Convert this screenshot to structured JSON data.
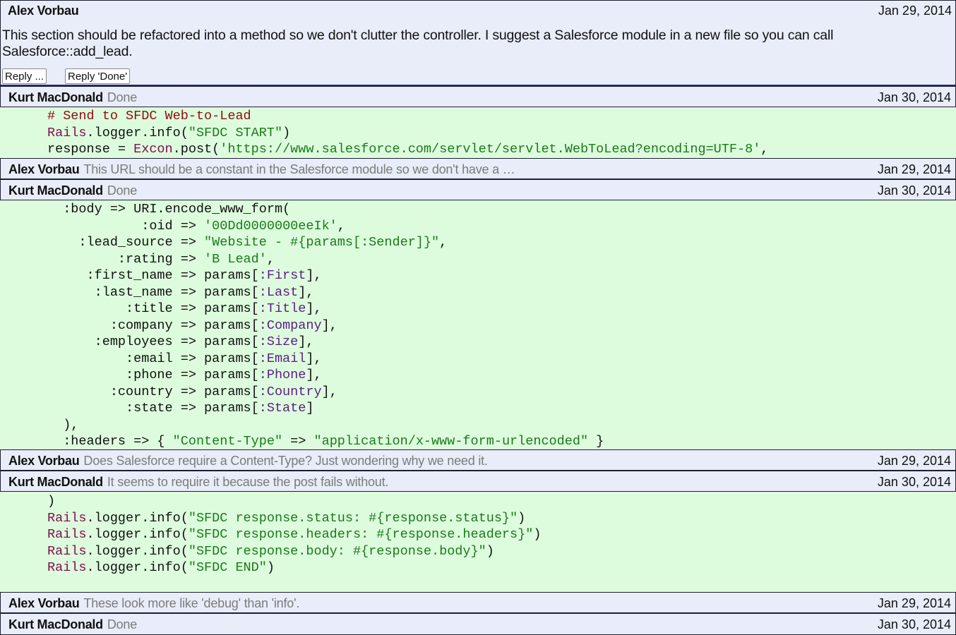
{
  "first_comment": {
    "author": "Alex Vorbau",
    "date": "Jan 29, 2014",
    "body_line1": "This section should be refactored into a method so we don't clutter the controller. I suggest a Salesforce module in a new file so you can call",
    "body_line2": "Salesforce::add_lead.",
    "reply_label": "Reply ...",
    "reply_done_label": "Reply 'Done'"
  },
  "threads": [
    {
      "author": "Kurt MacDonald",
      "message": "Done",
      "date": "Jan 30, 2014"
    },
    {
      "author": "Alex Vorbau",
      "message": "This URL should be a constant in the Salesforce module so we don't have a …",
      "date": "Jan 29, 2014"
    },
    {
      "author": "Kurt MacDonald",
      "message": "Done",
      "date": "Jan 30, 2014"
    },
    {
      "author": "Alex Vorbau",
      "message": "Does Salesforce require a Content-Type? Just wondering why we need it.",
      "date": "Jan 29, 2014"
    },
    {
      "author": "Kurt MacDonald",
      "message": "It seems to require it because the post fails without.",
      "date": "Jan 30, 2014"
    },
    {
      "author": "Alex Vorbau",
      "message": "These look more like 'debug' than 'info'.",
      "date": "Jan 29, 2014"
    },
    {
      "author": "Kurt MacDonald",
      "message": "Done",
      "date": "Jan 30, 2014"
    }
  ],
  "code_block_1": [
    [
      {
        "t": "# Send to SFDC Web-to-Lead",
        "c": "cmt"
      }
    ],
    [
      {
        "t": "Rails",
        "c": "kw-cls"
      },
      {
        "t": ".logger.info(",
        "c": ""
      },
      {
        "t": "\"SFDC START\"",
        "c": "str"
      },
      {
        "t": ")",
        "c": ""
      }
    ],
    [
      {
        "t": "response = ",
        "c": ""
      },
      {
        "t": "Excon",
        "c": "kw-cls"
      },
      {
        "t": ".post(",
        "c": ""
      },
      {
        "t": "'https://www.salesforce.com/servlet/servlet.WebToLead?encoding=UTF-8'",
        "c": "str"
      },
      {
        "t": ",",
        "c": ""
      }
    ]
  ],
  "code_block_2": [
    [
      {
        "t": "  :body => URI.encode_www_form(",
        "c": ""
      }
    ],
    [
      {
        "t": "            :oid => ",
        "c": ""
      },
      {
        "t": "'00Dd0000000eeIk'",
        "c": "str"
      },
      {
        "t": ",",
        "c": ""
      }
    ],
    [
      {
        "t": "    :lead_source => ",
        "c": ""
      },
      {
        "t": "\"Website - #{params[:Sender]}\"",
        "c": "str"
      },
      {
        "t": ",",
        "c": ""
      }
    ],
    [
      {
        "t": "         :rating => ",
        "c": ""
      },
      {
        "t": "'B Lead'",
        "c": "str"
      },
      {
        "t": ",",
        "c": ""
      }
    ],
    [
      {
        "t": "     :first_name => params[",
        "c": ""
      },
      {
        "t": ":First",
        "c": "sym"
      },
      {
        "t": "],",
        "c": ""
      }
    ],
    [
      {
        "t": "      :last_name => params[",
        "c": ""
      },
      {
        "t": ":Last",
        "c": "sym"
      },
      {
        "t": "],",
        "c": ""
      }
    ],
    [
      {
        "t": "          :title => params[",
        "c": ""
      },
      {
        "t": ":Title",
        "c": "sym"
      },
      {
        "t": "],",
        "c": ""
      }
    ],
    [
      {
        "t": "        :company => params[",
        "c": ""
      },
      {
        "t": ":Company",
        "c": "sym"
      },
      {
        "t": "],",
        "c": ""
      }
    ],
    [
      {
        "t": "      :employees => params[",
        "c": ""
      },
      {
        "t": ":Size",
        "c": "sym"
      },
      {
        "t": "],",
        "c": ""
      }
    ],
    [
      {
        "t": "          :email => params[",
        "c": ""
      },
      {
        "t": ":Email",
        "c": "sym"
      },
      {
        "t": "],",
        "c": ""
      }
    ],
    [
      {
        "t": "          :phone => params[",
        "c": ""
      },
      {
        "t": ":Phone",
        "c": "sym"
      },
      {
        "t": "],",
        "c": ""
      }
    ],
    [
      {
        "t": "        :country => params[",
        "c": ""
      },
      {
        "t": ":Country",
        "c": "sym"
      },
      {
        "t": "],",
        "c": ""
      }
    ],
    [
      {
        "t": "          :state => params[",
        "c": ""
      },
      {
        "t": ":State",
        "c": "sym"
      },
      {
        "t": "]",
        "c": ""
      }
    ],
    [
      {
        "t": "  ),",
        "c": ""
      }
    ],
    [
      {
        "t": "  :headers => { ",
        "c": ""
      },
      {
        "t": "\"Content-Type\"",
        "c": "str"
      },
      {
        "t": " => ",
        "c": ""
      },
      {
        "t": "\"application/x-www-form-urlencoded\"",
        "c": "str"
      },
      {
        "t": " }",
        "c": ""
      }
    ]
  ],
  "code_block_3": [
    [
      {
        "t": ")",
        "c": ""
      }
    ],
    [
      {
        "t": "Rails",
        "c": "kw-cls"
      },
      {
        "t": ".logger.info(",
        "c": ""
      },
      {
        "t": "\"SFDC response.status: #{response.status}\"",
        "c": "str"
      },
      {
        "t": ")",
        "c": ""
      }
    ],
    [
      {
        "t": "Rails",
        "c": "kw-cls"
      },
      {
        "t": ".logger.info(",
        "c": ""
      },
      {
        "t": "\"SFDC response.headers: #{response.headers}\"",
        "c": "str"
      },
      {
        "t": ")",
        "c": ""
      }
    ],
    [
      {
        "t": "Rails",
        "c": "kw-cls"
      },
      {
        "t": ".logger.info(",
        "c": ""
      },
      {
        "t": "\"SFDC response.body: #{response.body}\"",
        "c": "str"
      },
      {
        "t": ")",
        "c": ""
      }
    ],
    [
      {
        "t": "Rails",
        "c": "kw-cls"
      },
      {
        "t": ".logger.info(",
        "c": ""
      },
      {
        "t": "\"SFDC END\"",
        "c": "str"
      },
      {
        "t": ")",
        "c": ""
      }
    ]
  ],
  "colors": {
    "comment_bg": "#e8edf9",
    "code_bg": "#ddfcdd",
    "border": "#1e2030",
    "muted_text": "#7b7b7b"
  }
}
